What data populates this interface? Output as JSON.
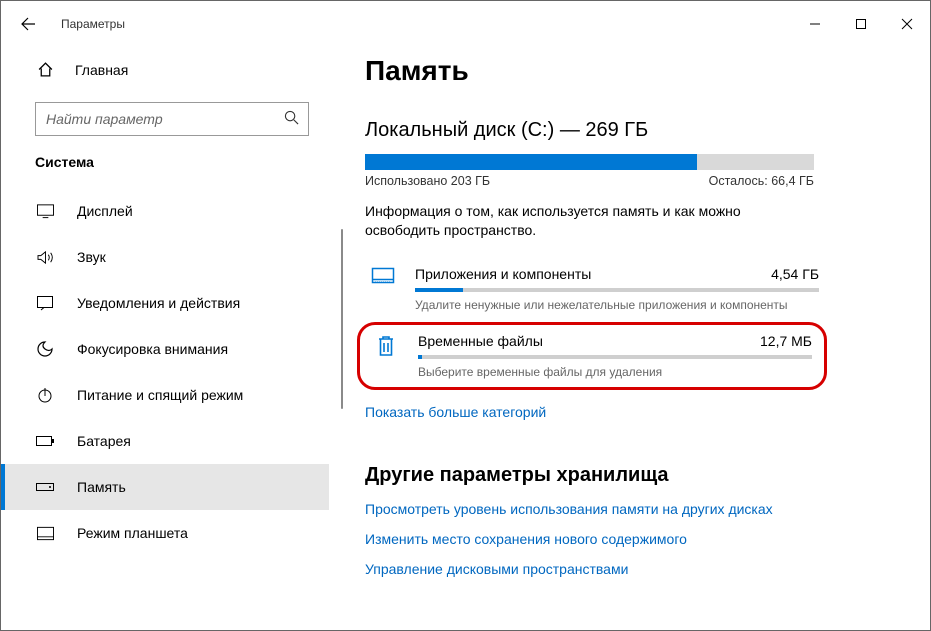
{
  "window": {
    "title": "Параметры"
  },
  "sidebar": {
    "home_label": "Главная",
    "search_placeholder": "Найти параметр",
    "category": "Система",
    "items": [
      {
        "label": "Дисплей"
      },
      {
        "label": "Звук"
      },
      {
        "label": "Уведомления и действия"
      },
      {
        "label": "Фокусировка внимания"
      },
      {
        "label": "Питание и спящий режим"
      },
      {
        "label": "Батарея"
      },
      {
        "label": "Память"
      },
      {
        "label": "Режим планшета"
      }
    ],
    "selected_index": 6
  },
  "main": {
    "title": "Память",
    "disk_heading": "Локальный диск (C:) — 269 ГБ",
    "used": {
      "label": "Использовано 203 ГБ",
      "percent": 74
    },
    "free": {
      "label": "Осталось: 66,4 ГБ"
    },
    "description": "Информация о том, как используется память и как можно освободить пространство.",
    "categories": [
      {
        "title": "Приложения и компоненты",
        "size": "4,54 ГБ",
        "hint": "Удалите ненужные или нежелательные приложения и компоненты",
        "percent": 12
      },
      {
        "title": "Временные файлы",
        "size": "12,7 МБ",
        "hint": "Выберите временные файлы для удаления",
        "percent": 1
      }
    ],
    "show_more": "Показать больше категорий",
    "other_title": "Другие параметры хранилища",
    "links": [
      "Просмотреть уровень использования памяти на других дисках",
      "Изменить место сохранения нового содержимого",
      "Управление дисковыми пространствами"
    ]
  }
}
